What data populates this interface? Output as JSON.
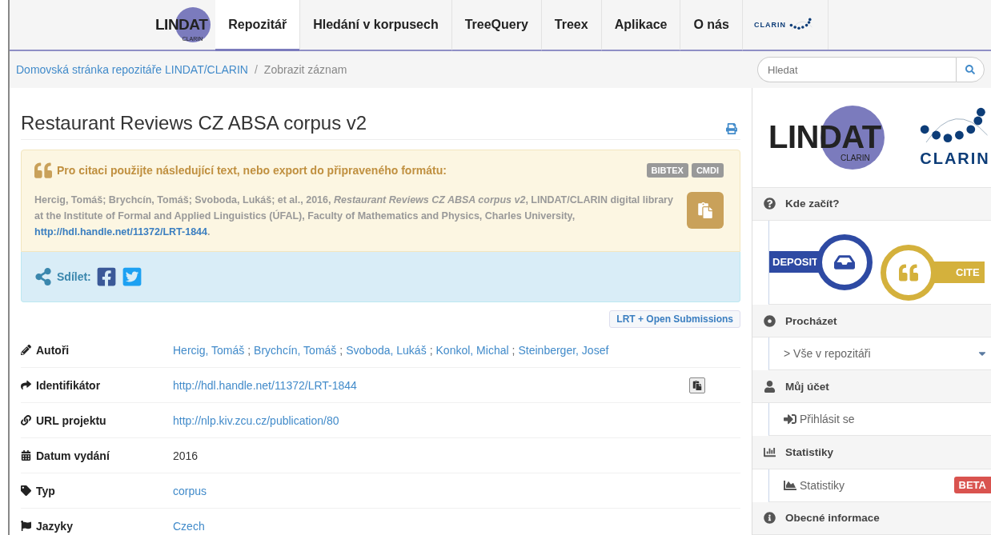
{
  "nav": {
    "logo": {
      "main": "LINDAT",
      "sub": "CLARIN"
    },
    "tabs": [
      {
        "label": "Repozitář",
        "selected": true
      },
      {
        "label": "Hledání v korpusech",
        "selected": false
      },
      {
        "label": "TreeQuery",
        "selected": false
      },
      {
        "label": "Treex",
        "selected": false
      },
      {
        "label": "Aplikace",
        "selected": false
      },
      {
        "label": "O nás",
        "selected": false
      }
    ],
    "partner_logo": "CLARIN"
  },
  "breadcrumb": {
    "items": [
      "Domovská stránka repozitáře LINDAT/CLARIN",
      "Zobrazit záznam"
    ],
    "separator": "/"
  },
  "search": {
    "placeholder": "Hledat"
  },
  "record": {
    "title": "Restaurant Reviews CZ ABSA corpus v2",
    "citation": {
      "heading": "Pro citaci použijte následující text, nebo export do připraveného formátu:",
      "formats": [
        "BIBTEX",
        "CMDI"
      ],
      "text": "Hercig, Tomáš; Brychcín, Tomáš; Svoboda, Lukáš; et al., 2016, *Restaurant Reviews CZ ABSA corpus v2*, LINDAT/CLARIN digital library at the Institute of Formal and Applied Linguistics (ÚFAL), Faculty of Mathematics and Physics, Charles University,",
      "link": "http://hdl.handle.net/11372/LRT-1844",
      "end": "."
    },
    "share": {
      "label": "Sdílet:"
    },
    "collection": "LRT + Open Submissions",
    "fields": [
      {
        "kind": "links",
        "label": "Autoři",
        "separator": ";",
        "values": [
          "Hercig, Tomáš",
          "Brychcín, Tomáš",
          "Svoboda, Lukáš",
          "Konkol, Michal",
          "Steinberger, Josef"
        ]
      },
      {
        "kind": "copy",
        "label": "Identifikátor",
        "values": [
          "http://hdl.handle.net/11372/LRT-1844"
        ]
      },
      {
        "kind": "links",
        "label": "URL projektu",
        "values": [
          "http://nlp.kiv.zcu.cz/publication/80"
        ]
      },
      {
        "kind": "text",
        "label": "Datum vydání",
        "values": [
          "2016"
        ]
      },
      {
        "kind": "links",
        "label": "Typ",
        "values": [
          "corpus"
        ]
      },
      {
        "kind": "links",
        "label": "Jazyky",
        "values": [
          "Czech"
        ]
      }
    ]
  },
  "sidebar": {
    "logos": {
      "lindat": {
        "main": "LINDAT",
        "sub": "CLARIN"
      },
      "clarin": "CLARIN"
    },
    "sections": [
      {
        "title": "Kde začít?",
        "kind": "banner",
        "deposit": "DEPOSIT",
        "cite": "CITE"
      },
      {
        "title": "Procházet",
        "kind": "list",
        "items": [
          {
            "label": "> Vše v repozitáři",
            "expandable": true
          }
        ]
      },
      {
        "title": "Můj účet",
        "kind": "list",
        "items": [
          {
            "label": "Přihlásit se",
            "expandable": false
          }
        ]
      },
      {
        "title": "Statistiky",
        "kind": "list",
        "items": [
          {
            "label": "Statistiky",
            "badge": "BETA",
            "expandable": false
          }
        ]
      },
      {
        "title": "Obecné informace",
        "kind": "header"
      }
    ]
  }
}
